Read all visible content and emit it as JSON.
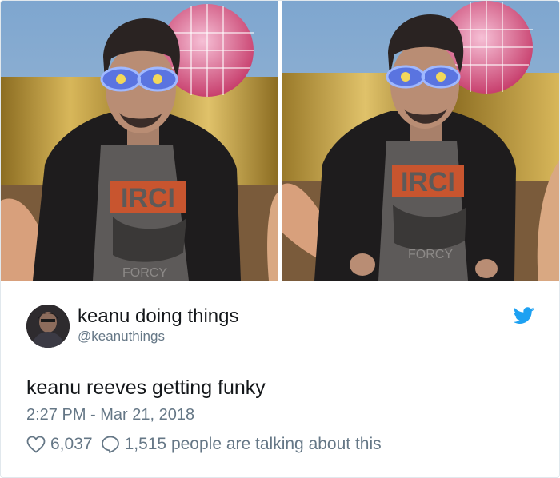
{
  "tweet": {
    "display_name": "keanu doing things",
    "handle": "@keanuthings",
    "text": "keanu reeves getting funky",
    "timestamp": "2:27 PM - Mar 21, 2018",
    "likes": "6,037",
    "talking": "1,515 people are talking about this"
  },
  "media": {
    "photos": [
      {
        "shirt_text": "IRCI",
        "shirt_subtext": "FORCY"
      },
      {
        "shirt_text": "IRCI",
        "shirt_subtext": "FORCY"
      }
    ]
  },
  "icons": {
    "avatar": "avatar-photo",
    "brand": "twitter-bird-icon",
    "like": "heart-icon",
    "reply": "speech-bubble-icon"
  },
  "colors": {
    "brand": "#1da1f2",
    "secondary_text": "#657786",
    "primary_text": "#14171a",
    "border": "#e1e8ed"
  }
}
